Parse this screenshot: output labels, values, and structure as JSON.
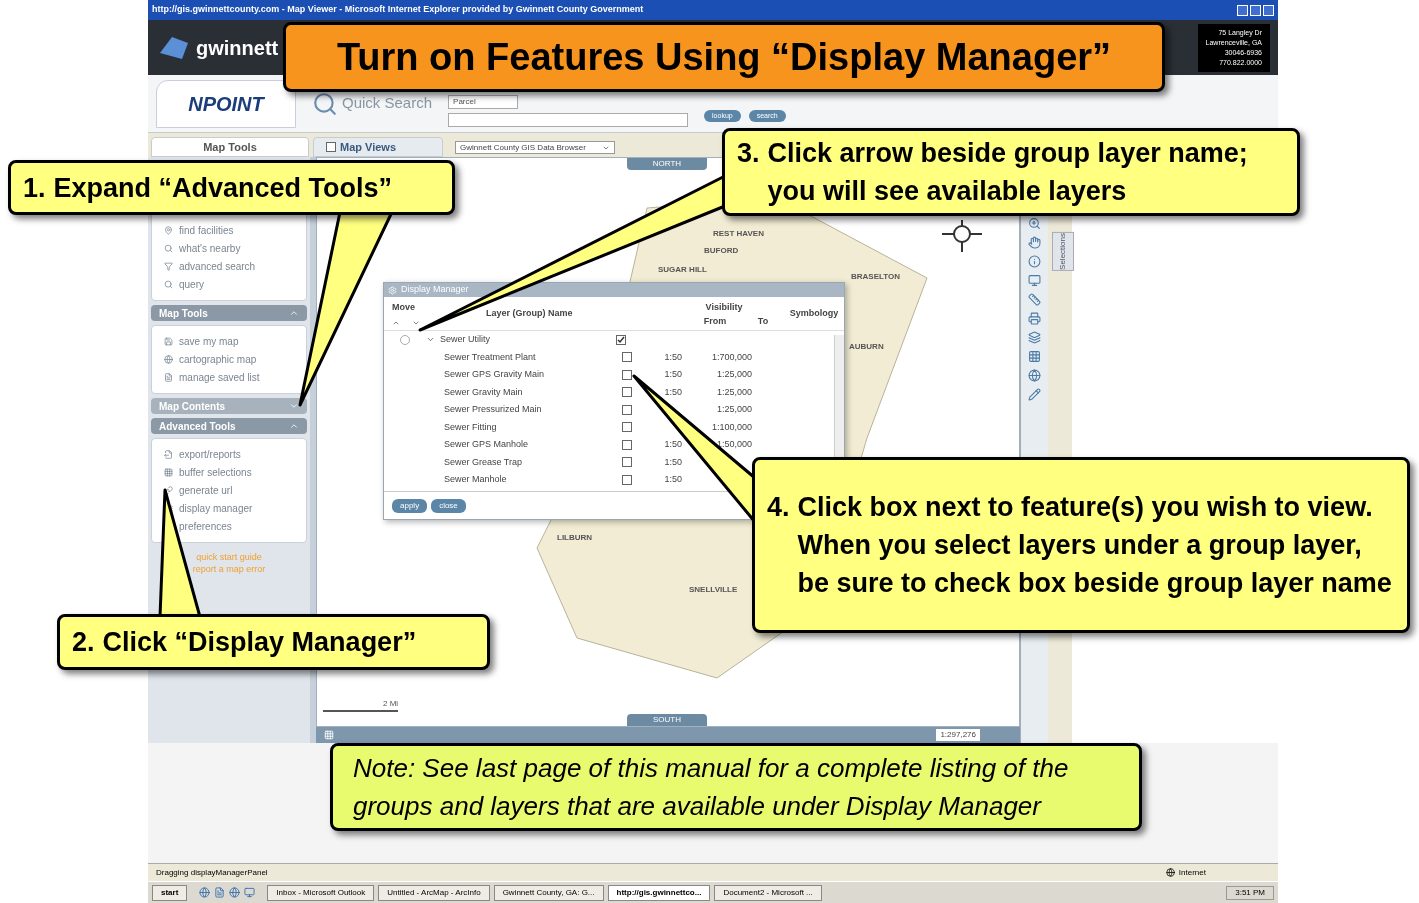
{
  "browser": {
    "title": "http://gis.gwinnettcounty.com - Map Viewer - Microsoft Internet Explorer provided by Gwinnett County Government",
    "address": [
      "75 Langley Dr",
      "Lawrenceville, GA",
      "30046-6936",
      "770.822.0000"
    ]
  },
  "header": {
    "logo": "gwinnett",
    "app_logo": "NPOINT",
    "quick_search": "Quick Search",
    "search_type": "Parcel",
    "buttons": [
      "lookup",
      "search"
    ]
  },
  "tabs": [
    {
      "label": "Map Tools",
      "selected": true
    },
    {
      "label": "Map Views",
      "selected": false
    }
  ],
  "map_view_select": "Gwinnett County GIS Data Browser",
  "sidebar": {
    "top_items": [
      "find facilities",
      "what's nearby",
      "advanced search",
      "query"
    ],
    "sections": [
      {
        "title": "Map Tools",
        "expanded": true,
        "items": [
          "save my map",
          "cartographic map",
          "manage saved list"
        ]
      },
      {
        "title": "Map Contents",
        "expanded": false
      },
      {
        "title": "Advanced Tools",
        "expanded": true,
        "items": [
          "export/reports",
          "buffer selections",
          "generate url",
          "display manager",
          "preferences"
        ]
      }
    ],
    "links": [
      "quick start guide",
      "report a map error"
    ]
  },
  "map": {
    "north": "NORTH",
    "south": "SOUTH",
    "places": [
      "REST HAVEN",
      "BUFORD",
      "SUGAR HILL",
      "BRASELTON",
      "AUBURN",
      "LILBURN",
      "SNELLVILLE"
    ],
    "scale_bar": "2 Mi",
    "scale": "1:297,276",
    "side_tab": "Selections"
  },
  "dialog": {
    "title": "Display Manager",
    "columns": {
      "move": "Move",
      "name": "Layer (Group) Name",
      "visibility": "Visibility",
      "from": "From",
      "to": "To",
      "symbology": "Symbology"
    },
    "group": {
      "name": "Sewer Utility",
      "checked": true,
      "expanded": true,
      "move_selected": false
    },
    "layers": [
      {
        "name": "Sewer Treatment Plant",
        "checked": false,
        "from": "1:50",
        "to": "1:700,000"
      },
      {
        "name": "Sewer GPS Gravity Main",
        "checked": false,
        "from": "1:50",
        "to": "1:25,000"
      },
      {
        "name": "Sewer Gravity Main",
        "checked": false,
        "from": "1:50",
        "to": "1:25,000"
      },
      {
        "name": "Sewer Pressurized Main",
        "checked": false,
        "to": "1:25,000"
      },
      {
        "name": "Sewer Fitting",
        "checked": false,
        "to": "1:100,000"
      },
      {
        "name": "Sewer GPS Manhole",
        "checked": false,
        "from": "1:50",
        "to": "1:50,000"
      },
      {
        "name": "Sewer Grease Trap",
        "checked": false,
        "from": "1:50"
      },
      {
        "name": "Sewer Manhole",
        "checked": false,
        "from": "1:50"
      }
    ],
    "buttons": [
      "apply",
      "close"
    ]
  },
  "status_bar": {
    "text": "Dragging displayManagerPanel",
    "zone": "Internet"
  },
  "taskbar": {
    "start": "start",
    "tasks": [
      {
        "label": "Inbox - Microsoft Outlook",
        "selected": false
      },
      {
        "label": "Untitled - ArcMap - ArcInfo",
        "selected": false
      },
      {
        "label": "Gwinnett County, GA: G...",
        "selected": false
      },
      {
        "label": "http://gis.gwinnettco...",
        "selected": true
      },
      {
        "label": "Document2 - Microsoft ...",
        "selected": false
      }
    ],
    "time": "3:51 PM"
  },
  "callouts": [
    {
      "kind": "title",
      "text": "Turn on Features Using “Display Manager”"
    },
    {
      "kind": "step",
      "number": "1.",
      "text": "Expand “Advanced Tools”"
    },
    {
      "kind": "step",
      "number": "2.",
      "text": "Click “Display Manager”"
    },
    {
      "kind": "step",
      "number": "3.",
      "text": "Click arrow beside group layer name; you will see available layers"
    },
    {
      "kind": "step",
      "number": "4.",
      "text": "Click box next to feature(s) you wish to view. When you select layers under a group layer, be sure to check box beside group layer name"
    },
    {
      "kind": "note",
      "text": "Note: See last page of this manual for a complete listing of the groups and layers that are available under Display Manager"
    }
  ]
}
